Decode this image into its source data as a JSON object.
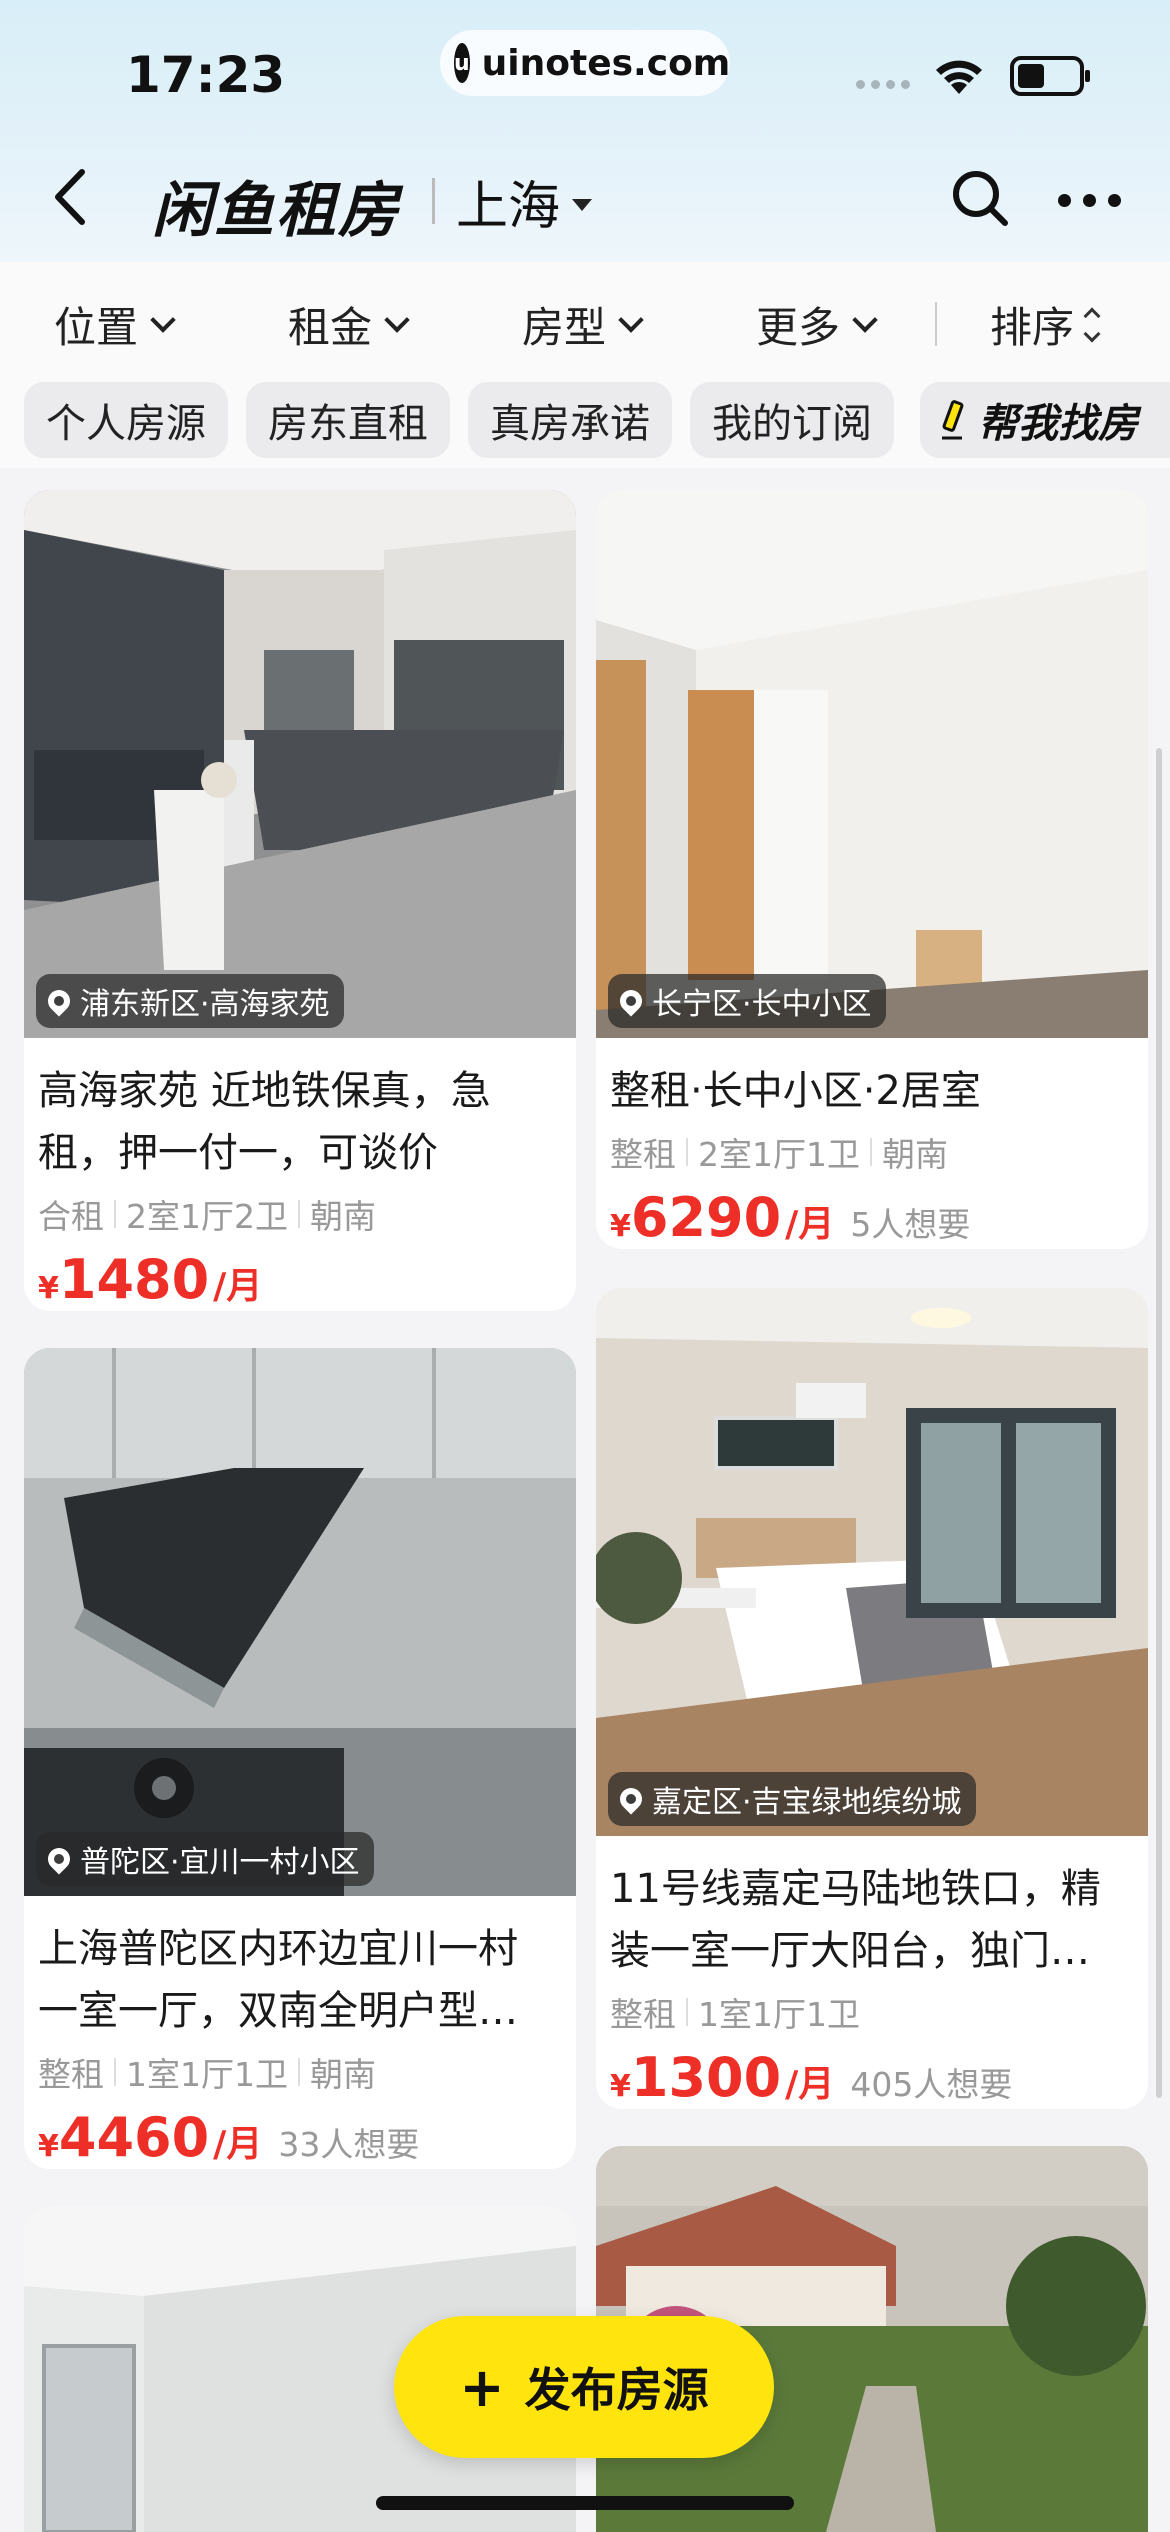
{
  "status": {
    "time": "17:23",
    "url": "uinotes.com"
  },
  "header": {
    "brand": "闲鱼租房",
    "city": "上海"
  },
  "filters": {
    "location": "位置",
    "rent": "租金",
    "layout": "房型",
    "more": "更多",
    "sort": "排序"
  },
  "chips": [
    "个人房源",
    "房东直租",
    "真房承诺",
    "我的订阅"
  ],
  "help_chip": "帮我找房",
  "listings": [
    {
      "location": "浦东新区·高海家苑",
      "title_line1": "高海家苑 近地铁保真，急",
      "title_line2": "租，押一付一，可谈价",
      "meta": [
        "合租",
        "2室1厅2卫",
        "朝南"
      ],
      "yen": "¥",
      "price": "1480",
      "unit": "/月",
      "want": ""
    },
    {
      "location": "长宁区·长中小区",
      "title_line1": "整租·长中小区·2居室",
      "title_line2": "",
      "meta": [
        "整租",
        "2室1厅1卫",
        "朝南"
      ],
      "yen": "¥",
      "price": "6290",
      "unit": "/月",
      "want": "5人想要"
    },
    {
      "location": "普陀区·宜川一村小区",
      "title_line1": "上海普陀区内环边宜川一村",
      "title_line2": "一室一厅，双南全明户型…",
      "meta": [
        "整租",
        "1室1厅1卫",
        "朝南"
      ],
      "yen": "¥",
      "price": "4460",
      "unit": "/月",
      "want": "33人想要"
    },
    {
      "location": "嘉定区·吉宝绿地缤纷城",
      "title_line1": "11号线嘉定马陆地铁口，精",
      "title_line2": "装一室一厅大阳台，独门…",
      "meta": [
        "整租",
        "1室1厅1卫"
      ],
      "yen": "¥",
      "price": "1300",
      "unit": "/月",
      "want": "405人想要"
    }
  ],
  "fab": {
    "plus": "+",
    "label": "发布房源"
  },
  "colors": {
    "accent_red": "#ee2f27",
    "fab_yellow": "#ffe50d"
  }
}
